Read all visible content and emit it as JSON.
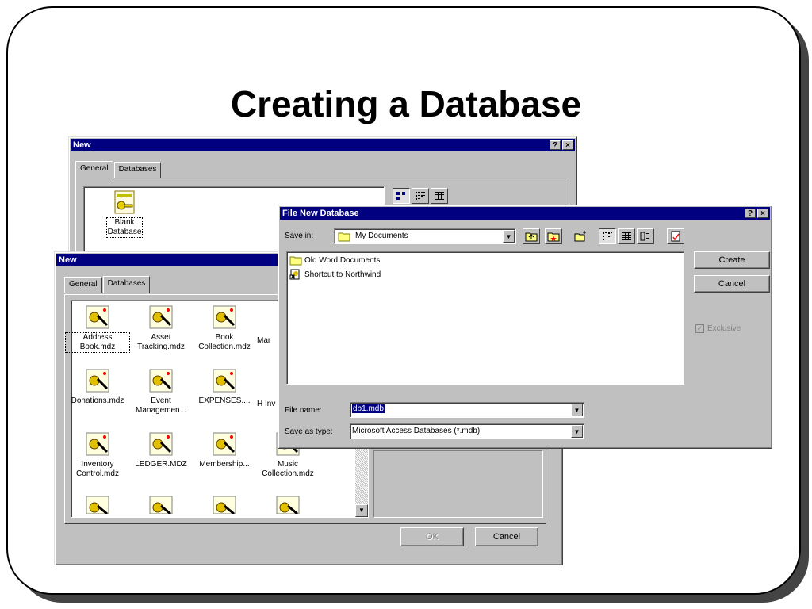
{
  "slide": {
    "title": "Creating a Database"
  },
  "new_dialog_back": {
    "title": "New",
    "help_btn": "?",
    "close_btn": "×",
    "tabs": [
      "General",
      "Databases"
    ],
    "item": "Blank\nDatabase",
    "view_icons": [
      "large-icons-icon",
      "list-view-icon",
      "details-view-icon"
    ]
  },
  "new_dialog_front": {
    "title": "New",
    "tabs": [
      "General",
      "Databases"
    ],
    "items": [
      "Address Book.mdz",
      "Asset Tracking.mdz",
      "Book Collection.mdz",
      "Mar",
      "Donations.mdz",
      "Event Managemen...",
      "EXPENSES....",
      "H Inv",
      "Inventory Control.mdz",
      "LEDGER.MDZ",
      "Membership...",
      "Music Collection.mdz"
    ],
    "ok_label": "OK",
    "cancel_label": "Cancel"
  },
  "file_dialog": {
    "title": "File New Database",
    "help_btn": "?",
    "close_btn": "×",
    "save_in_label": "Save in:",
    "save_in_value": "My Documents",
    "files": [
      "Old Word Documents",
      "Shortcut to Northwind"
    ],
    "create_label": "Create",
    "cancel_label": "Cancel",
    "exclusive_label": "Exclusive",
    "file_name_label": "File name:",
    "file_name_value": "db1.mdb",
    "save_as_type_label": "Save as type:",
    "save_as_type_value": "Microsoft Access Databases (*.mdb)"
  },
  "colors": {
    "titlebar": "#000080",
    "window": "#c0c0c0",
    "selection": "#000080"
  }
}
